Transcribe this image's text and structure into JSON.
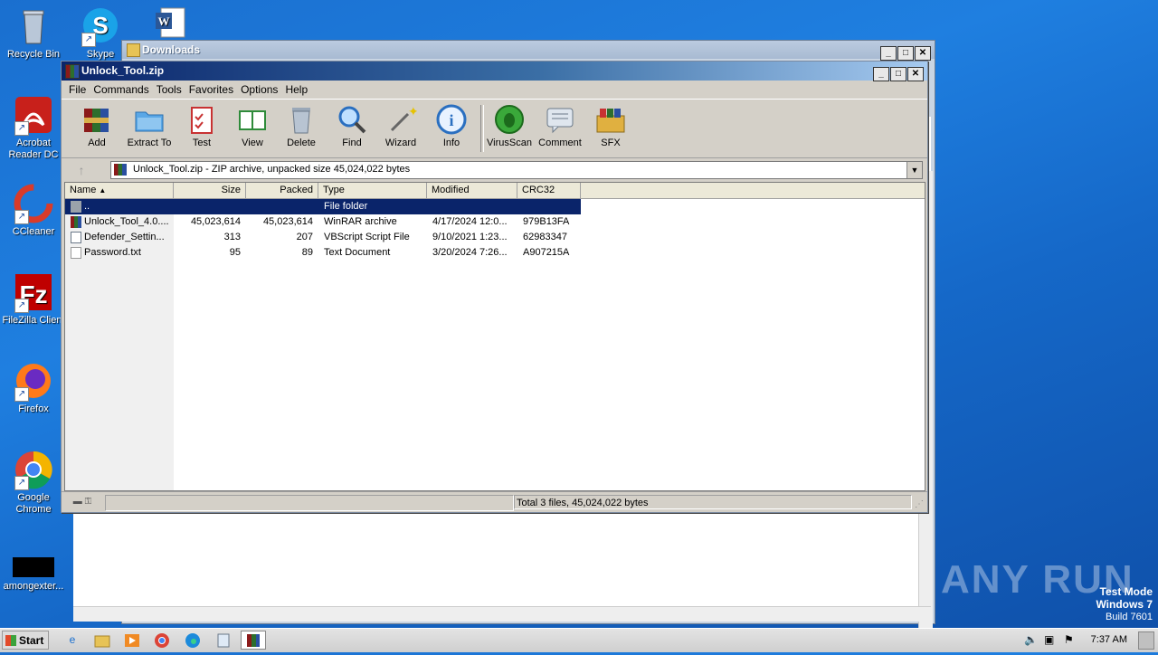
{
  "desktop": {
    "icons": [
      {
        "label": "Recycle Bin"
      },
      {
        "label": "Skype"
      },
      {
        "label": "Acrobat Reader DC"
      },
      {
        "label": "CCleaner"
      },
      {
        "label": "FileZilla Client"
      },
      {
        "label": "Firefox"
      },
      {
        "label": "Google Chrome"
      },
      {
        "label": "amongexter..."
      }
    ],
    "watermark": "ANY RUN",
    "test_mode": {
      "line1": "Test Mode",
      "line2": "Windows 7",
      "line3": "Build 7601"
    }
  },
  "downloads_window": {
    "title": "Downloads"
  },
  "winrar": {
    "title": "Unlock_Tool.zip",
    "menu": [
      "File",
      "Commands",
      "Tools",
      "Favorites",
      "Options",
      "Help"
    ],
    "toolbar": [
      {
        "label": "Add",
        "icon": "add-archive-icon",
        "color": "#8b1a1a"
      },
      {
        "label": "Extract To",
        "icon": "extract-folder-icon",
        "color": "#3b8fd6"
      },
      {
        "label": "Test",
        "icon": "test-clipboard-icon",
        "color": "#c83232"
      },
      {
        "label": "View",
        "icon": "view-book-icon",
        "color": "#2e8b3a"
      },
      {
        "label": "Delete",
        "icon": "trash-icon",
        "color": "#8a98a8"
      },
      {
        "label": "Find",
        "icon": "magnifier-icon",
        "color": "#2a6fc0"
      },
      {
        "label": "Wizard",
        "icon": "magic-wand-icon",
        "color": "#d0d060"
      },
      {
        "label": "Info",
        "icon": "info-icon",
        "color": "#2a6fc0"
      },
      {
        "label": "VirusScan",
        "icon": "virus-bug-icon",
        "color": "#2e9a2e"
      },
      {
        "label": "Comment",
        "icon": "comment-icon",
        "color": "#8c9db0"
      },
      {
        "label": "SFX",
        "icon": "sfx-books-icon",
        "color": "#c85a2a"
      }
    ],
    "address": "Unlock_Tool.zip - ZIP archive, unpacked size 45,024,022 bytes",
    "columns": {
      "name": "Name",
      "size": "Size",
      "packed": "Packed",
      "type": "Type",
      "modified": "Modified",
      "crc": "CRC32"
    },
    "rows": [
      {
        "name": "..",
        "size": "",
        "packed": "",
        "type": "File folder",
        "modified": "",
        "crc": "",
        "icon": "parent-folder-icon"
      },
      {
        "name": "Unlock_Tool_4.0....",
        "size": "45,023,614",
        "packed": "45,023,614",
        "type": "WinRAR archive",
        "modified": "4/17/2024 12:0...",
        "crc": "979B13FA",
        "icon": "rar-archive-icon"
      },
      {
        "name": "Defender_Settin...",
        "size": "313",
        "packed": "207",
        "type": "VBScript Script File",
        "modified": "9/10/2021 1:23...",
        "crc": "62983347",
        "icon": "vbscript-file-icon"
      },
      {
        "name": "Password.txt",
        "size": "95",
        "packed": "89",
        "type": "Text Document",
        "modified": "3/20/2024 7:26...",
        "crc": "A907215A",
        "icon": "text-file-icon"
      }
    ],
    "status": "Total 3 files, 45,024,022 bytes"
  },
  "taskbar": {
    "start": "Start",
    "clock": "7:37 AM"
  }
}
